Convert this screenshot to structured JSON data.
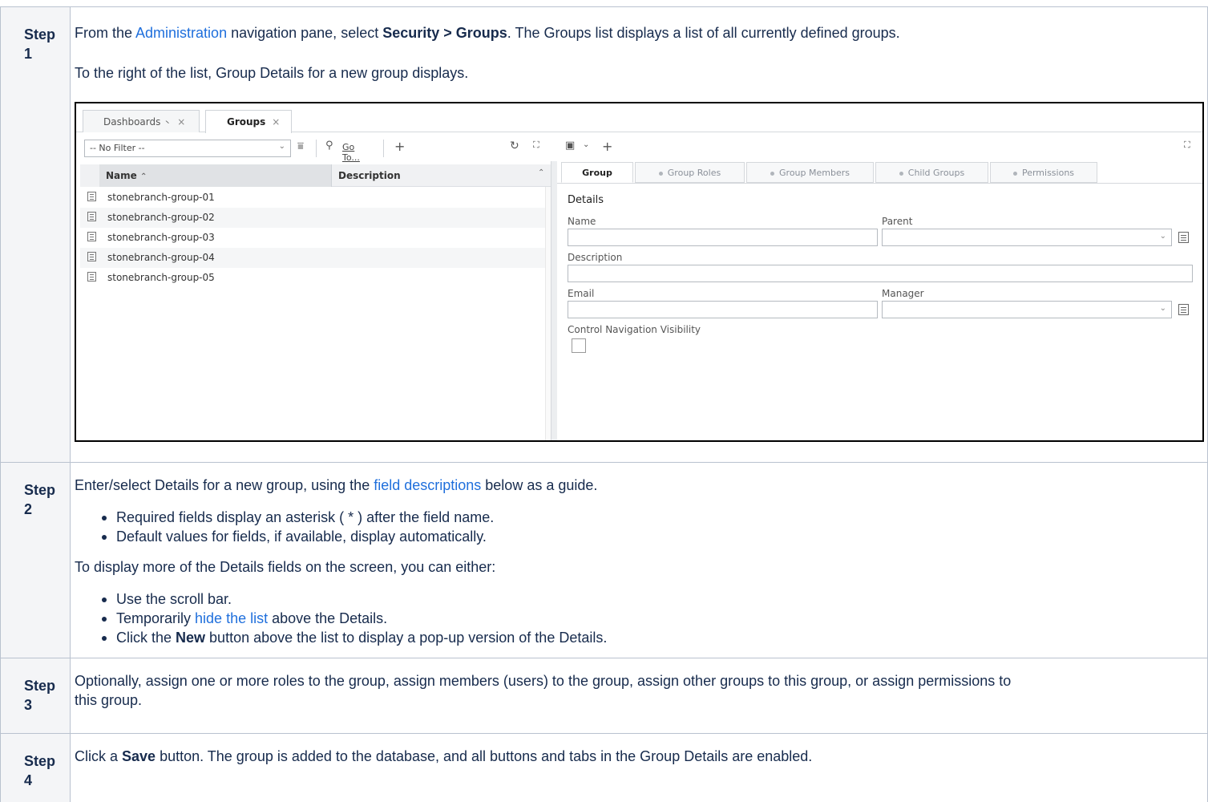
{
  "steps": [
    {
      "label": "Step 1",
      "line1": {
        "pre": "From the ",
        "link": "Administration",
        "mid": " navigation pane, select ",
        "bold": "Security > Groups",
        "post": ". The Groups list displays a list of all currently defined groups."
      },
      "line2": "To the right of the list, Group Details for a new group displays."
    },
    {
      "label": "Step 2",
      "intro": {
        "pre": "Enter/select Details for a new group, using the ",
        "link": "field descriptions",
        "post": " below as a guide."
      },
      "bullets1": [
        "Required fields display an asterisk ( * ) after the field name.",
        "Default values for fields, if available, display automatically."
      ],
      "para": "To display more of the Details fields on the screen, you can either:",
      "bullets2": {
        "b1": "Use the scroll bar.",
        "b2_pre": "Temporarily ",
        "b2_link": "hide the list",
        "b2_post": " above the Details.",
        "b3_pre": "Click the ",
        "b3_bold": "New",
        "b3_post": " button above the list to display a pop-up version of the Details."
      }
    },
    {
      "label": "Step 3",
      "line1": "Optionally, assign one or more roles to the group, assign members (users) to the group, assign other groups to this group, or assign permissions to",
      "line2": "this group."
    },
    {
      "label": "Step 4",
      "pre": "Click a ",
      "bold": "Save",
      "post": " button. The group is added to the database, and all buttons and tabs in the Group Details are enabled."
    }
  ],
  "app": {
    "tabs": [
      {
        "label": "Dashboards",
        "pin": "⼂",
        "close": "×"
      },
      {
        "label": "Groups",
        "close": "×"
      }
    ],
    "filter": {
      "value": "-- No Filter --"
    },
    "goto_label": "Go To...",
    "list": {
      "columns": {
        "name": "Name",
        "description": "Description"
      },
      "rows": [
        "stonebranch-group-01",
        "stonebranch-group-02",
        "stonebranch-group-03",
        "stonebranch-group-04",
        "stonebranch-group-05"
      ]
    },
    "detail_tabs": [
      "Group",
      "Group Roles",
      "Group Members",
      "Child Groups",
      "Permissions"
    ],
    "details": {
      "section": "Details",
      "name_label": "Name",
      "parent_label": "Parent",
      "description_label": "Description",
      "email_label": "Email",
      "manager_label": "Manager",
      "cnv_label": "Control Navigation Visibility"
    },
    "icons": [
      "filter-icon",
      "search-icon",
      "plus-icon",
      "refresh-icon",
      "expand-icon",
      "save-icon",
      "chevron-down-icon",
      "list-icon",
      "lookup-icon"
    ]
  },
  "colors": {
    "link": "#1f6fdc",
    "label_bg": "#f4f5f7",
    "border": "#b9c2cf"
  }
}
